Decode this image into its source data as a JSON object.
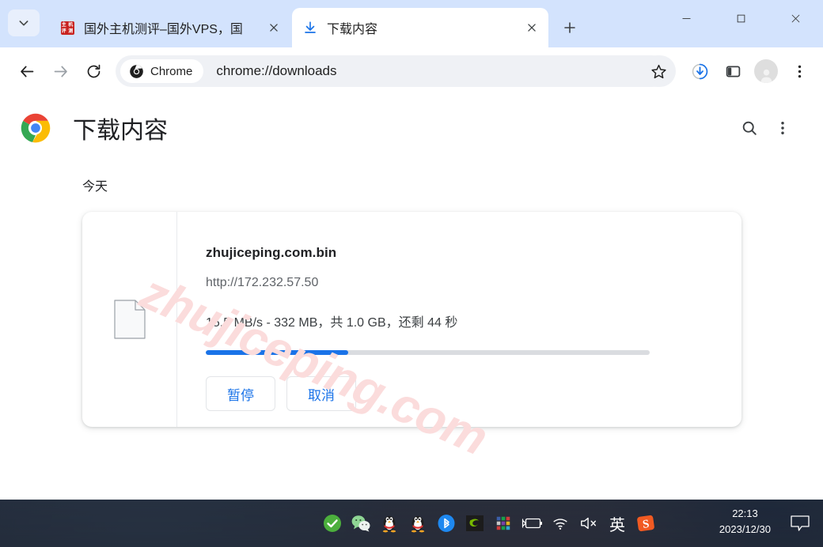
{
  "window": {
    "controls": {
      "minimize": "minimize-button",
      "maximize": "maximize-button",
      "close": "close-button"
    }
  },
  "tabstrip": {
    "tab_search_tooltip": "搜索标签页",
    "tabs": [
      {
        "title": "国外主机测评–国外VPS，国",
        "favicon": "red-square-favicon",
        "active": false
      },
      {
        "title": "下载内容",
        "favicon": "download-icon",
        "active": true
      }
    ],
    "new_tab_label": "+"
  },
  "toolbar": {
    "back": "后退",
    "forward": "前进",
    "reload": "重新加载",
    "chip_label": "Chrome",
    "url": "chrome://downloads",
    "bookmark": "收藏此标签页",
    "downloads": "下载内容",
    "side_panel": "侧边栏",
    "profile": "个人资料",
    "menu": "自定义及控制"
  },
  "page": {
    "title": "下载内容",
    "search_label": "搜索下载内容",
    "more_label": "更多操作",
    "day_group": "今天",
    "watermark": "zhujiceping.com",
    "download": {
      "file_name": "zhujiceping.com.bin",
      "url": "http://172.232.57.50",
      "status": "15.5 MB/s - 332 MB，共 1.0 GB，还剩 44 秒",
      "speed": "15.5 MB/s",
      "downloaded": "332 MB",
      "total_size": "1.0 GB",
      "time_remaining": "44 秒",
      "progress_percent": 32,
      "progress_color": "#1a73e8",
      "file_icon": "generic-file-icon",
      "buttons": [
        {
          "label": "暂停",
          "name": "pause-download-button"
        },
        {
          "label": "取消",
          "name": "cancel-download-button"
        }
      ]
    }
  },
  "taskbar": {
    "tray_icons": [
      "green-check-icon",
      "wechat-icon",
      "qq-penguin-icon",
      "qq-penguin-icon-2",
      "bluetooth-icon",
      "nvidia-icon",
      "color-grid-icon",
      "battery-charging-icon",
      "wifi-icon",
      "speaker-muted-icon"
    ],
    "ime": "英",
    "sogou": "S",
    "time": "22:13",
    "date": "2023/12/30",
    "notification": "notification-bubble-icon"
  },
  "colors": {
    "tabstrip_bg": "#d3e3fd",
    "accent_blue": "#1a73e8",
    "link_blue": "#1a73e8",
    "watermark_pink": "#fbdcdc"
  }
}
